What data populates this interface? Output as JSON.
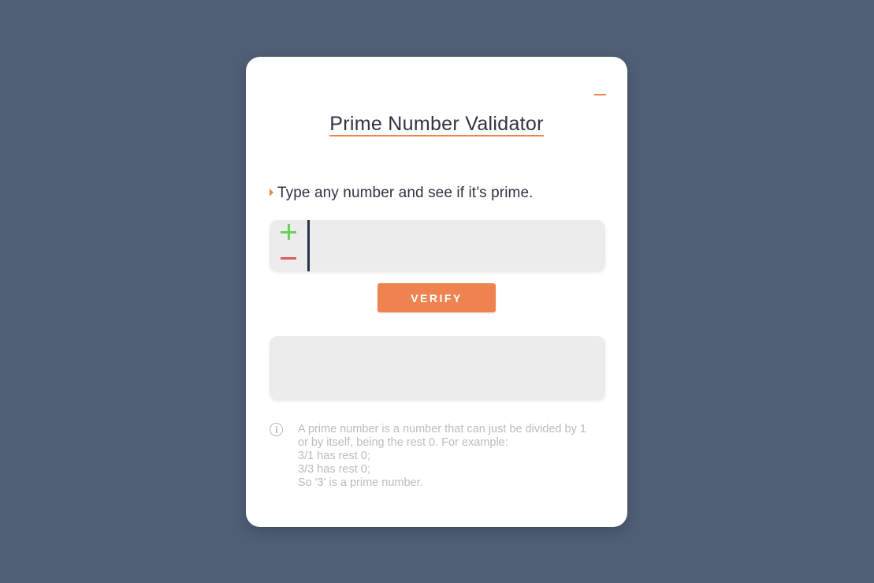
{
  "app": {
    "title": "Prime Number Validator"
  },
  "prompt": {
    "label": "Type any number and see if it’s prime."
  },
  "input": {
    "value": "",
    "placeholder": ""
  },
  "buttons": {
    "verify_label": "VERIFY"
  },
  "result": {
    "text": ""
  },
  "info": {
    "lines": [
      "A prime number is a number that can just be divided by 1",
      "or by itself, being the rest 0. For example:",
      "3/1 has rest 0;",
      "3/3 has rest 0;",
      "So '3' is a prime number."
    ]
  },
  "icons": {
    "minimize": "minimize-icon",
    "increment": "plus-icon",
    "decrement": "minus-icon",
    "info": "info-icon",
    "bullet": "caret-right-icon"
  },
  "colors": {
    "background": "#505f76",
    "accent": "#ef8350",
    "plus": "#6dcf5e",
    "minus": "#e05a5a",
    "text": "#2e3442",
    "muted": "#bcbcbc"
  }
}
